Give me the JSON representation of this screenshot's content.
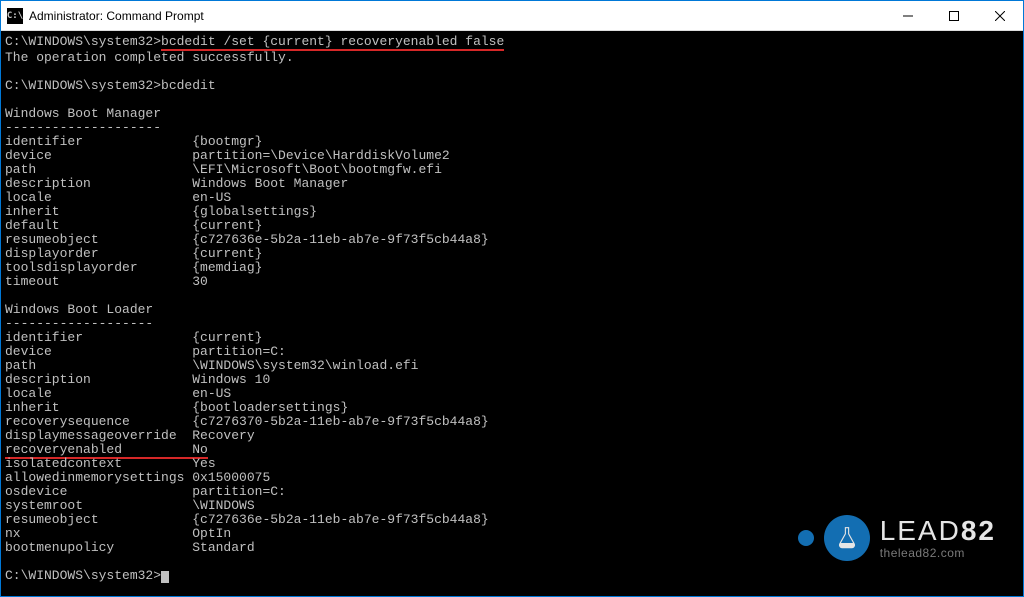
{
  "window": {
    "title": "Administrator: Command Prompt",
    "icon_label": "C:\\"
  },
  "prompts": {
    "p1": "C:\\WINDOWS\\system32>",
    "p2": "C:\\WINDOWS\\system32>",
    "p3": "C:\\WINDOWS\\system32>"
  },
  "commands": {
    "c1": "bcdedit /set {current} recoveryenabled false",
    "c2": "bcdedit"
  },
  "messages": {
    "op_ok": "The operation completed successfully."
  },
  "sections": {
    "boot_manager": {
      "header": "Windows Boot Manager",
      "rule": "--------------------",
      "rows": [
        {
          "k": "identifier",
          "v": "{bootmgr}"
        },
        {
          "k": "device",
          "v": "partition=\\Device\\HarddiskVolume2"
        },
        {
          "k": "path",
          "v": "\\EFI\\Microsoft\\Boot\\bootmgfw.efi"
        },
        {
          "k": "description",
          "v": "Windows Boot Manager"
        },
        {
          "k": "locale",
          "v": "en-US"
        },
        {
          "k": "inherit",
          "v": "{globalsettings}"
        },
        {
          "k": "default",
          "v": "{current}"
        },
        {
          "k": "resumeobject",
          "v": "{c727636e-5b2a-11eb-ab7e-9f73f5cb44a8}"
        },
        {
          "k": "displayorder",
          "v": "{current}"
        },
        {
          "k": "toolsdisplayorder",
          "v": "{memdiag}"
        },
        {
          "k": "timeout",
          "v": "30"
        }
      ]
    },
    "boot_loader": {
      "header": "Windows Boot Loader",
      "rule": "-------------------",
      "rows": [
        {
          "k": "identifier",
          "v": "{current}"
        },
        {
          "k": "device",
          "v": "partition=C:"
        },
        {
          "k": "path",
          "v": "\\WINDOWS\\system32\\winload.efi"
        },
        {
          "k": "description",
          "v": "Windows 10"
        },
        {
          "k": "locale",
          "v": "en-US"
        },
        {
          "k": "inherit",
          "v": "{bootloadersettings}"
        },
        {
          "k": "recoverysequence",
          "v": "{c7276370-5b2a-11eb-ab7e-9f73f5cb44a8}"
        },
        {
          "k": "displaymessageoverride",
          "v": "Recovery"
        },
        {
          "k": "recoveryenabled",
          "v": "No",
          "hl": true
        },
        {
          "k": "isolatedcontext",
          "v": "Yes"
        },
        {
          "k": "allowedinmemorysettings",
          "v": "0x15000075"
        },
        {
          "k": "osdevice",
          "v": "partition=C:"
        },
        {
          "k": "systemroot",
          "v": "\\WINDOWS"
        },
        {
          "k": "resumeobject",
          "v": "{c727636e-5b2a-11eb-ab7e-9f73f5cb44a8}"
        },
        {
          "k": "nx",
          "v": "OptIn"
        },
        {
          "k": "bootmenupolicy",
          "v": "Standard"
        }
      ]
    }
  },
  "branding": {
    "word1": "LEAD",
    "word2": "82",
    "site": "thelead82.com"
  },
  "layout": {
    "key_width": 24
  }
}
